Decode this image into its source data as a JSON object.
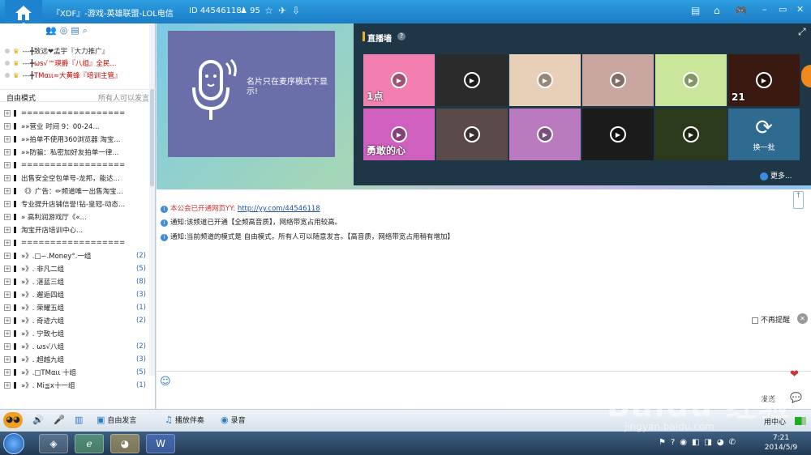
{
  "window": {
    "title": "『XDF』-游戏-英雄联盟-LOL电信",
    "channel_id": "ID 44546118",
    "online_count": "95",
    "home_count": "0"
  },
  "left_panel": {
    "vip_users": [
      {
        "prefix": "---╋",
        "name": "致远❤孟宇『大力推广』"
      },
      {
        "prefix": "---╋",
        "name": "ωs√™瑛爵『八组』全民..."
      },
      {
        "prefix": "---╋",
        "name": "TMαιι≈大黄蜂『培训主管』"
      }
    ],
    "mode": {
      "label": "自由模式",
      "right": "所有人可以发言"
    },
    "channels": [
      {
        "type": "bar",
        "text": "=================="
      },
      {
        "type": "pm",
        "text": "»»营业 时间 9：00-24..."
      },
      {
        "type": "pm",
        "text": "»»拍单不使用360浏览器 淘宝..."
      },
      {
        "type": "pm",
        "text": "»»防骗：私密加好友拍单一律..."
      },
      {
        "type": "bar",
        "text": "=================="
      },
      {
        "type": "pm",
        "text": "出售安全空包单号-龙邦，能达..."
      },
      {
        "type": "pm",
        "text": "  《》广告：✏频道唯一出售淘宝..."
      },
      {
        "type": "pm",
        "text": "专业提升店铺信誉!钻-皇冠-动态..."
      },
      {
        "type": "pm",
        "text": "             » 高利润游戏厅《«..."
      },
      {
        "type": "bar",
        "text": "              淘宝开店培训中心..."
      },
      {
        "type": "bar",
        "text": "=================="
      },
      {
        "type": "pm",
        "text": "»》.□∽.Money°.一组",
        "n": "(2)"
      },
      {
        "type": "pm",
        "text": "»》.    非凡二组",
        "n": "(5)"
      },
      {
        "type": "pm",
        "text": "»》.    湛蓝三组",
        "n": "(8)"
      },
      {
        "type": "pm",
        "text": "»》.    邂逅四组",
        "n": "(3)"
      },
      {
        "type": "pm",
        "text": "»》.    荣耀五组",
        "n": "(1)"
      },
      {
        "type": "pm",
        "text": "»》.    奇迹六组",
        "n": "(2)"
      },
      {
        "type": "pm",
        "text": "»》.    宁致七组",
        "n": ""
      },
      {
        "type": "pm",
        "text": "»》.    ωs√八组",
        "n": "(2)"
      },
      {
        "type": "pm",
        "text": "»》.    超越九组",
        "n": "(3)"
      },
      {
        "type": "pm",
        "text": "»》.□TMαιι 十组",
        "n": "(5)"
      },
      {
        "type": "pm",
        "text": "»》.    Mi≦x十一组",
        "n": "(1)"
      }
    ]
  },
  "stage": {
    "mic_text": "名片只在麦序模式下显示!",
    "live_title": "直播墙",
    "refresh_label": "换一批",
    "more_label": "更多..."
  },
  "live_tiles": [
    {
      "bg": "#f27fb0",
      "label": "1点"
    },
    {
      "bg": "#2b2b2b",
      "label": ""
    },
    {
      "bg": "#e8d0b8",
      "label": ""
    },
    {
      "bg": "#c9a6a0",
      "label": ""
    },
    {
      "bg": "#c9e69b",
      "label": ""
    },
    {
      "bg": "#3a1a10",
      "label": "21"
    },
    {
      "bg": "#d060c0",
      "label": "勇敢的心"
    },
    {
      "bg": "#5a4a4a",
      "label": ""
    },
    {
      "bg": "#b97ac0",
      "label": ""
    },
    {
      "bg": "#1b1b1b",
      "label": ""
    },
    {
      "bg": "#2b3a1a",
      "label": ""
    },
    {
      "bg": "#1a1a1a",
      "label": ""
    }
  ],
  "chat": {
    "messages": [
      {
        "prefix": "本公会已开通网页YY:",
        "link": "http://yy.com/44546118"
      },
      {
        "prefix": "通知:",
        "text": "该频道已开通【全频高音质】，网络带宽占用较高。"
      },
      {
        "prefix": "通知:",
        "text": "当前频道的模式是 自由模式，所有人可以随意发言。【高音质，网络带宽占用稍有增加】"
      }
    ],
    "no_remind": "不再提醒",
    "send": "发送"
  },
  "bottom_bar": {
    "free_speak": "自由发言",
    "accompany": "播放伴奏",
    "record": "录音",
    "app_center": "用中心"
  },
  "taskbar": {
    "time": "7:21",
    "date": "2014/5/9"
  },
  "watermark": {
    "main": "Baidu 经验",
    "sub": "jingyan.baidu.com"
  }
}
